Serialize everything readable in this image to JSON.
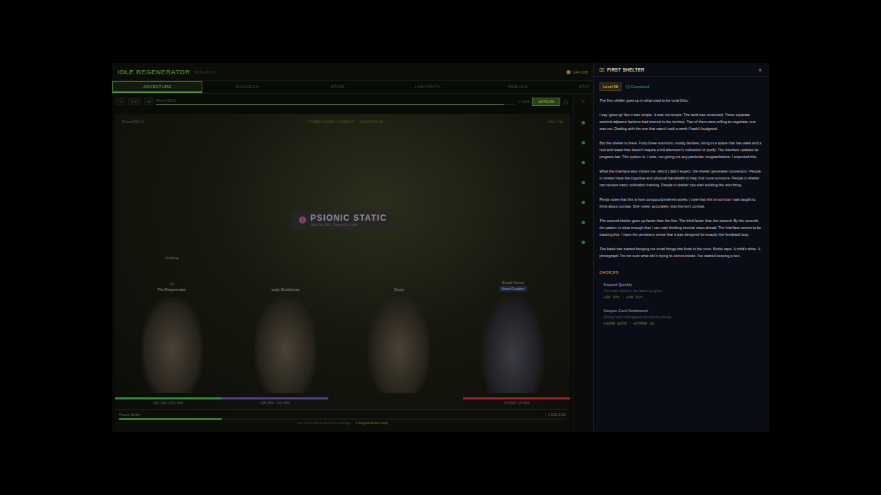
{
  "window": {
    "title": "IDLE REGENERATOR",
    "build": "BETA_BUILD",
    "gold": "144.32B"
  },
  "tabs": [
    {
      "label": "ADVENTURE",
      "selected": true
    },
    {
      "label": "DUNGEON",
      "selected": false
    },
    {
      "label": "SPIRE",
      "selected": false
    },
    {
      "label": "LABYRINTH",
      "selected": false
    },
    {
      "label": "REBUILD",
      "selected": false
    },
    {
      "label": "STAT",
      "selected": false
    }
  ],
  "round_bar": {
    "chips": [
      "1x",
      "5187",
      "88"
    ],
    "label": "Round 58/10",
    "level": 0.97,
    "right_label": "1x 9999",
    "auto": "AUTO ON",
    "auto_on": true
  },
  "battle": {
    "round": "Round 58/10",
    "modes": "⚡ TURBO MODE • COMBAT ↑ • ANIMATIONS ↓",
    "kills": "Kills 7.6k",
    "effect": {
      "title": "PSIONIC STATIC",
      "detail": "Your Crit -20% · Enemy Crit +15%"
    },
    "fighters": [
      {
        "name": "The Regenerator",
        "pre": "Lvl",
        "pet": "Snapling",
        "tag": "",
        "side": "party"
      },
      {
        "name": "Lady Brickhouse",
        "pre": "",
        "pet": "",
        "tag": "",
        "side": "party"
      },
      {
        "name": "Dusty",
        "pre": "",
        "pet": "",
        "tag": "",
        "side": "party"
      },
      {
        "name": "Brood Horror",
        "pre": "",
        "pet": "",
        "tag": "Novel Creation",
        "side": "enemy"
      }
    ],
    "hp": [
      {
        "reading": "832.20M / 832.36M",
        "level": 1,
        "color": "#2f8f3a",
        "side": "party"
      },
      {
        "reading": "438.36M / 438.36M",
        "level": 1,
        "color": "#5b3f8f",
        "side": "party"
      },
      {
        "reading": "15.83M / 15.84M",
        "level": 1,
        "color": "#a3222c",
        "side": "enemy"
      }
    ]
  },
  "skill": {
    "name": "Focus Strike",
    "level": 0.23,
    "reading": "⚡ 1,523 5/20",
    "hint": "Your next 3 attacks deal bonus damage",
    "ready": "3 charged attacks ready"
  },
  "side": {
    "close": "✕",
    "markers": [
      {
        "done": true
      },
      {
        "done": true
      },
      {
        "done": true
      },
      {
        "done": true
      },
      {
        "done": true
      },
      {
        "done": true
      },
      {
        "done": true
      }
    ]
  },
  "panel": {
    "title": "FIRST SHELTER",
    "close": "×",
    "level": "Level 58",
    "status": "Completed",
    "completed": true,
    "paragraphs": [
      "The first shelter goes up in what used to be rural Ohio.",
      "I say 'goes up' like it was simple. It was not simple. The land was contested. Three separate warlord-adjacent factions had interest in the territory. Two of them were willing to negotiate; one was not. Dealing with the one that wasn't took a week I hadn't budgeted.",
      "But the shelter is there. Forty-three survivors, mostly families, living in a space that has walls and a roof and water that doesn't require a full afternoon's cultivation to purify. The Interface updates its progress bar. The system is, I note, not giving me any particular congratulations. I expected this.",
      "What the Interface also shows me, which I didn't expect: the shelter generates momentum. People in shelter have the cognitive and physical bandwidth to help find more survivors. People in shelter can receive basic cultivation training. People in shelter can start building the next thing.",
      "Renja notes that this is how compound interest works. I note that this is not how I was taught to think about combat. She notes, accurately, that this isn't combat.",
      "The second shelter goes up faster than the first. The third faster than the second. By the seventh, the pattern is clear enough that I can start thinking several steps ahead. The Interface seems to be tracking this. I have the persistent sense that it was designed for exactly this feedback loop.",
      "The hawk has started bringing me small things she finds in the ruins. Bottle caps. A child's shoe. A photograph. I'm not sure what she's trying to communicate. I've started keeping a box."
    ],
    "choices_label": "CHOICES",
    "choices": [
      {
        "title": "Expand Quickly",
        "description": "The more shelters, the faster we grow.",
        "reward": "+50 Str · +50 Vit"
      },
      {
        "title": "Deepen Each Settlement",
        "description": "Strong roots hold against the storms coming.",
        "reward": "+1000 gold · +25000 xp"
      }
    ]
  }
}
